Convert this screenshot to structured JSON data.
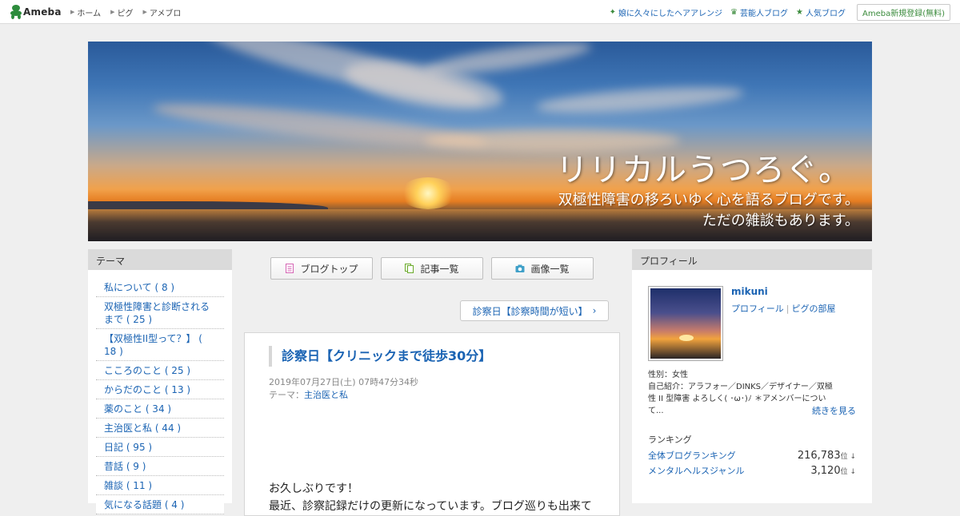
{
  "header": {
    "logo": "Ameba",
    "nav": [
      "ホーム",
      "ピグ",
      "アメブロ"
    ],
    "right_links": [
      {
        "label": "娘に久々にしたヘアアレンジ",
        "icon": "sparkle-icon"
      },
      {
        "label": "芸能人ブログ",
        "icon": "crown-icon"
      },
      {
        "label": "人気ブログ",
        "icon": "star-icon"
      }
    ],
    "register": "Ameba新規登録(無料)"
  },
  "banner": {
    "title": "リリカルうつろぐ。",
    "subtitle_line1": "双極性障害の移ろいゆく心を語るブログです。",
    "subtitle_line2": "ただの雑談もあります。"
  },
  "left": {
    "heading": "テーマ",
    "themes": [
      "私について ( 8 )",
      "双極性障害と診断されるまで ( 25 )",
      "【双極性II型って？】 ( 18 )",
      "こころのこと ( 25 )",
      "からだのこと ( 13 )",
      "薬のこと ( 34 )",
      "主治医と私 ( 44 )",
      "日記 ( 95 )",
      "昔話 ( 9 )",
      "雑談 ( 11 )",
      "気になる話題 ( 4 )"
    ]
  },
  "main": {
    "buttons": [
      {
        "label": "ブログトップ",
        "icon": "document-icon",
        "color": "#d565b4"
      },
      {
        "label": "記事一覧",
        "icon": "copy-icon",
        "color": "#6aaa2a"
      },
      {
        "label": "画像一覧",
        "icon": "camera-icon",
        "color": "#3fa0c8"
      }
    ],
    "next_article": "診察日【診察時間が短い】",
    "article": {
      "title": "診察日【クリニックまで徒歩30分】",
      "date": "2019年07月27日(土) 07時47分34秒",
      "theme_prefix": "テーマ：",
      "theme": "主治医と私",
      "body_line1": "お久しぶりです！",
      "body_line2": "最近、診察記録だけの更新になっています。ブログ巡りも出来て"
    }
  },
  "right": {
    "heading": "プロフィール",
    "username": "mikuni",
    "profile_link": "プロフィール",
    "pig_link": "ピグの部屋",
    "gender": "性別：女性",
    "intro": "自己紹介：アラフォー／DINKS／デザイナー／双極性 II 型障害 よろしく( ･ω･)ﾉ ＊アメンバーについて...",
    "more": "続きを見る",
    "ranking_heading": "ランキング",
    "rankings": [
      {
        "label": "全体ブログランキング",
        "value": "216,783",
        "unit": "位 ↓"
      },
      {
        "label": "メンタルヘルスジャンル",
        "value": "3,120",
        "unit": "位 ↓"
      }
    ]
  }
}
